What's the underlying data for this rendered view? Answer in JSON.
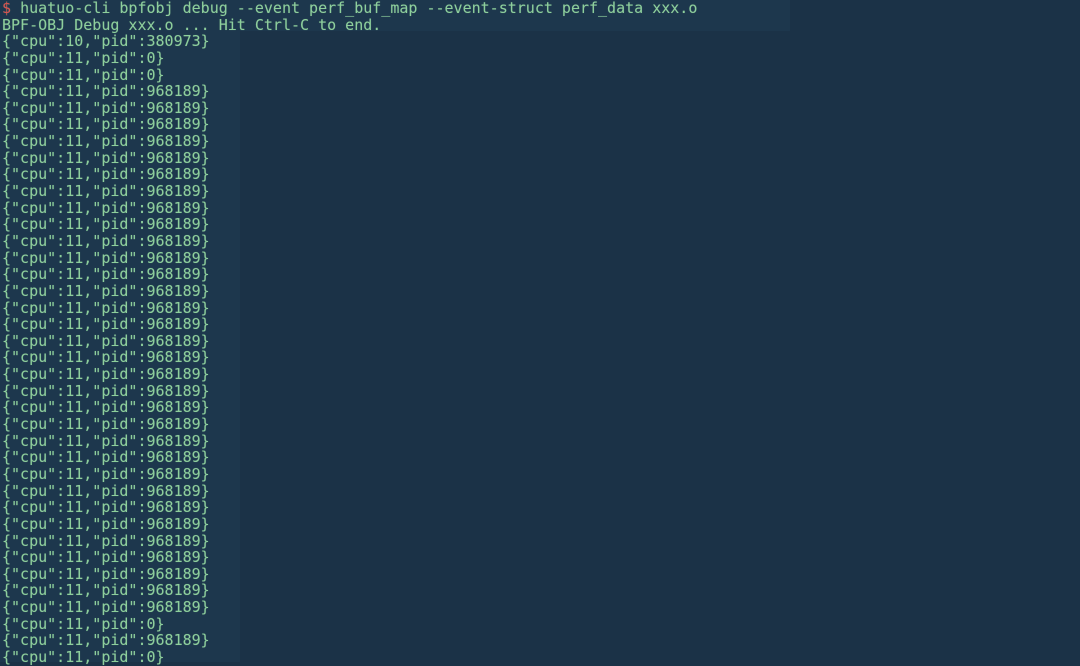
{
  "terminal": {
    "title": "terminal",
    "colors": {
      "background": "#1b3247",
      "band": "#1d374d",
      "text": "#8ecf9c",
      "prompt": "#d9534f"
    },
    "prompt_symbol": "$",
    "command": "huatuo-cli bpfobj debug --event perf_buf_map --event-struct perf_data xxx.o",
    "banner": "BPF-OBJ Debug xxx.o ... Hit Ctrl-C to end.",
    "output_lines": [
      "{\"cpu\":10,\"pid\":380973}",
      "{\"cpu\":11,\"pid\":0}",
      "{\"cpu\":11,\"pid\":0}",
      "{\"cpu\":11,\"pid\":968189}",
      "{\"cpu\":11,\"pid\":968189}",
      "{\"cpu\":11,\"pid\":968189}",
      "{\"cpu\":11,\"pid\":968189}",
      "{\"cpu\":11,\"pid\":968189}",
      "{\"cpu\":11,\"pid\":968189}",
      "{\"cpu\":11,\"pid\":968189}",
      "{\"cpu\":11,\"pid\":968189}",
      "{\"cpu\":11,\"pid\":968189}",
      "{\"cpu\":11,\"pid\":968189}",
      "{\"cpu\":11,\"pid\":968189}",
      "{\"cpu\":11,\"pid\":968189}",
      "{\"cpu\":11,\"pid\":968189}",
      "{\"cpu\":11,\"pid\":968189}",
      "{\"cpu\":11,\"pid\":968189}",
      "{\"cpu\":11,\"pid\":968189}",
      "{\"cpu\":11,\"pid\":968189}",
      "{\"cpu\":11,\"pid\":968189}",
      "{\"cpu\":11,\"pid\":968189}",
      "{\"cpu\":11,\"pid\":968189}",
      "{\"cpu\":11,\"pid\":968189}",
      "{\"cpu\":11,\"pid\":968189}",
      "{\"cpu\":11,\"pid\":968189}",
      "{\"cpu\":11,\"pid\":968189}",
      "{\"cpu\":11,\"pid\":968189}",
      "{\"cpu\":11,\"pid\":968189}",
      "{\"cpu\":11,\"pid\":968189}",
      "{\"cpu\":11,\"pid\":968189}",
      "{\"cpu\":11,\"pid\":968189}",
      "{\"cpu\":11,\"pid\":968189}",
      "{\"cpu\":11,\"pid\":968189}",
      "{\"cpu\":11,\"pid\":968189}",
      "{\"cpu\":11,\"pid\":0}",
      "{\"cpu\":11,\"pid\":968189}",
      "{\"cpu\":11,\"pid\":0}"
    ]
  }
}
